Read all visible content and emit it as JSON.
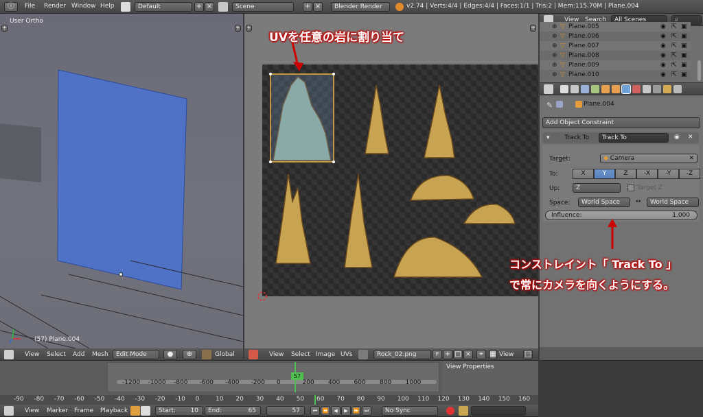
{
  "topbar": {
    "menus": [
      "File",
      "Render",
      "Window",
      "Help"
    ],
    "screen_layout": "Default",
    "scene": "Scene",
    "render_engine": "Blender Render",
    "stats": "v2.74 | Verts:4/4 | Edges:4/4 | Faces:1/1 | Tris:2 | Mem:115.70M | Plane.004"
  },
  "view3d": {
    "view_label": "User Ortho",
    "object_label": "(57) Plane.004",
    "footer": {
      "view": "View",
      "select": "Select",
      "add": "Add",
      "mesh": "Mesh",
      "mode": "Edit Mode",
      "orientation": "Global"
    }
  },
  "uv_editor": {
    "footer": {
      "view": "View",
      "select": "Select",
      "image": "Image",
      "uvs": "UVs",
      "image_name": "Rock_02.png",
      "fake_user": "F",
      "view2": "View"
    }
  },
  "outliner": {
    "view": "View",
    "search": "Search",
    "scope": "All Scenes",
    "items": [
      "Plane.005",
      "Plane.006",
      "Plane.007",
      "Plane.008",
      "Plane.009",
      "Plane.010"
    ]
  },
  "properties": {
    "object_name": "Plane.004",
    "add_constraint": "Add Object Constraint",
    "constraint_type": "Track To",
    "constraint_name": "Track To",
    "target_label": "Target:",
    "target_value": "Camera",
    "to_label": "To:",
    "axes": [
      "X",
      "Y",
      "Z",
      "-X",
      "-Y",
      "-Z"
    ],
    "active_axis": "Y",
    "up_label": "Up:",
    "up_value": "Z",
    "target_z": "Target Z",
    "space_label": "Space:",
    "owner_space": "World Space",
    "target_space": "World Space",
    "influence_label": "Influence:",
    "influence_value": "1.000"
  },
  "timeline": {
    "ticks": [
      "-1200",
      "-1000",
      "-800",
      "-600",
      "-400",
      "-200",
      "0",
      "200",
      "400",
      "600",
      "800",
      "1000"
    ],
    "current": "57",
    "view_properties": "View Properties",
    "ruler_ticks": [
      "-90",
      "-80",
      "-70",
      "-60",
      "-50",
      "-40",
      "-30",
      "-20",
      "-10",
      "0",
      "10",
      "20",
      "30",
      "40",
      "50",
      "60",
      "70",
      "80",
      "90",
      "100",
      "110",
      "120",
      "130",
      "140",
      "150",
      "160"
    ],
    "footer": {
      "view": "View",
      "marker": "Marker",
      "frame": "Frame",
      "playback": "Playback",
      "start_label": "Start:",
      "start": "10",
      "end_label": "End:",
      "end": "65",
      "current": "57",
      "sync": "No Sync"
    }
  },
  "annotations": {
    "uv_note": "UVを任意の岩に割り当て",
    "constraint_note_line1": "コンストレイント「 Track To 」",
    "constraint_note_line2": "で常にカメラを向くようにする。"
  },
  "colors": {
    "accent": "#5a82bd",
    "annotation": "#c00000",
    "mesh_face": "#4f72c6"
  }
}
